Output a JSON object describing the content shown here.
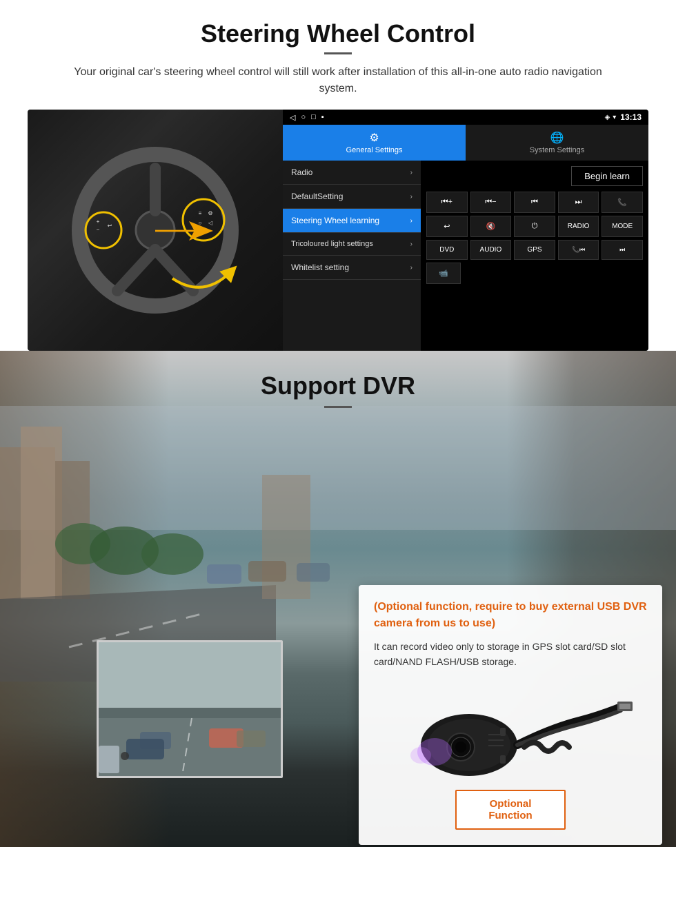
{
  "steering_section": {
    "title": "Steering Wheel Control",
    "subtitle": "Your original car's steering wheel control will still work after installation of this all-in-one auto radio navigation system.",
    "status_bar": {
      "time": "13:13",
      "nav_icons": [
        "◁",
        "○",
        "□",
        "▪"
      ]
    },
    "tabs": [
      {
        "id": "general",
        "icon": "⚙",
        "label": "General Settings",
        "active": true
      },
      {
        "id": "system",
        "icon": "🌐",
        "label": "System Settings",
        "active": false
      }
    ],
    "menu_items": [
      {
        "id": "radio",
        "label": "Radio",
        "active": false
      },
      {
        "id": "default",
        "label": "DefaultSetting",
        "active": false
      },
      {
        "id": "steering",
        "label": "Steering Wheel learning",
        "active": true
      },
      {
        "id": "tricoloured",
        "label": "Tricoloured light settings",
        "active": false
      },
      {
        "id": "whitelist",
        "label": "Whitelist setting",
        "active": false
      }
    ],
    "begin_learn_label": "Begin learn",
    "control_buttons": [
      "⏮+",
      "⏮−",
      "⏮",
      "⏭",
      "📞",
      "↩",
      "🔇",
      "⏻",
      "RADIO",
      "MODE",
      "DVD",
      "AUDIO",
      "GPS",
      "📞⏮",
      "⏭"
    ]
  },
  "dvr_section": {
    "title": "Support DVR",
    "card": {
      "title": "(Optional function, require to buy external USB DVR camera from us to use)",
      "body": "It can record video only to storage in GPS slot card/SD slot card/NAND FLASH/USB storage.",
      "optional_function_label": "Optional Function"
    }
  }
}
